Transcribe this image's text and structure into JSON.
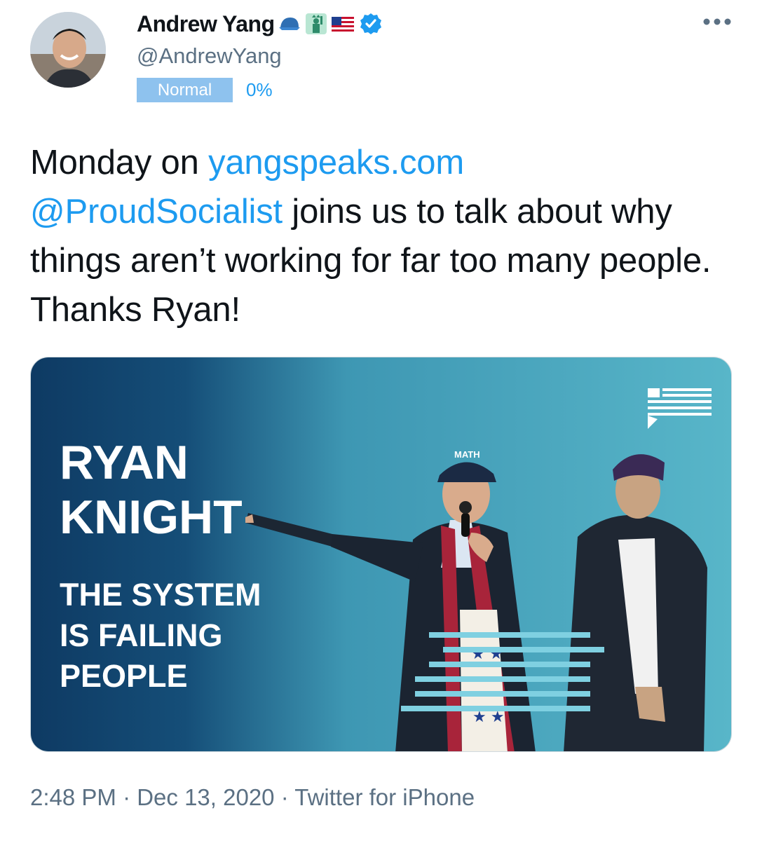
{
  "author": {
    "display_name": "Andrew Yang",
    "handle": "@AndrewYang",
    "emojis": [
      "cap-icon",
      "statue-of-liberty-icon",
      "us-flag-icon"
    ],
    "verified": true
  },
  "status": {
    "badge": "Normal",
    "percent": "0%"
  },
  "tweet": {
    "text_1": "Monday on ",
    "link_1": "yangspeaks.com",
    "mention": "@ProudSocialist",
    "text_2": " joins us to talk about why things aren’t working for far too many people.  Thanks Ryan!"
  },
  "media": {
    "title_line1": "RYAN",
    "title_line2": "KNIGHT",
    "subtitle_line1": "THE SYSTEM",
    "subtitle_line2": "IS FAILING",
    "subtitle_line3": "PEOPLE",
    "cap_text": "MATH"
  },
  "meta": {
    "line": "2:48 PM · Dec 13, 2020 · Twitter for iPhone"
  },
  "colors": {
    "accent": "#1d9bf0",
    "secondary_text": "#5b7083",
    "banner_dark": "#0e3a63",
    "banner_light": "#56b4c7"
  }
}
